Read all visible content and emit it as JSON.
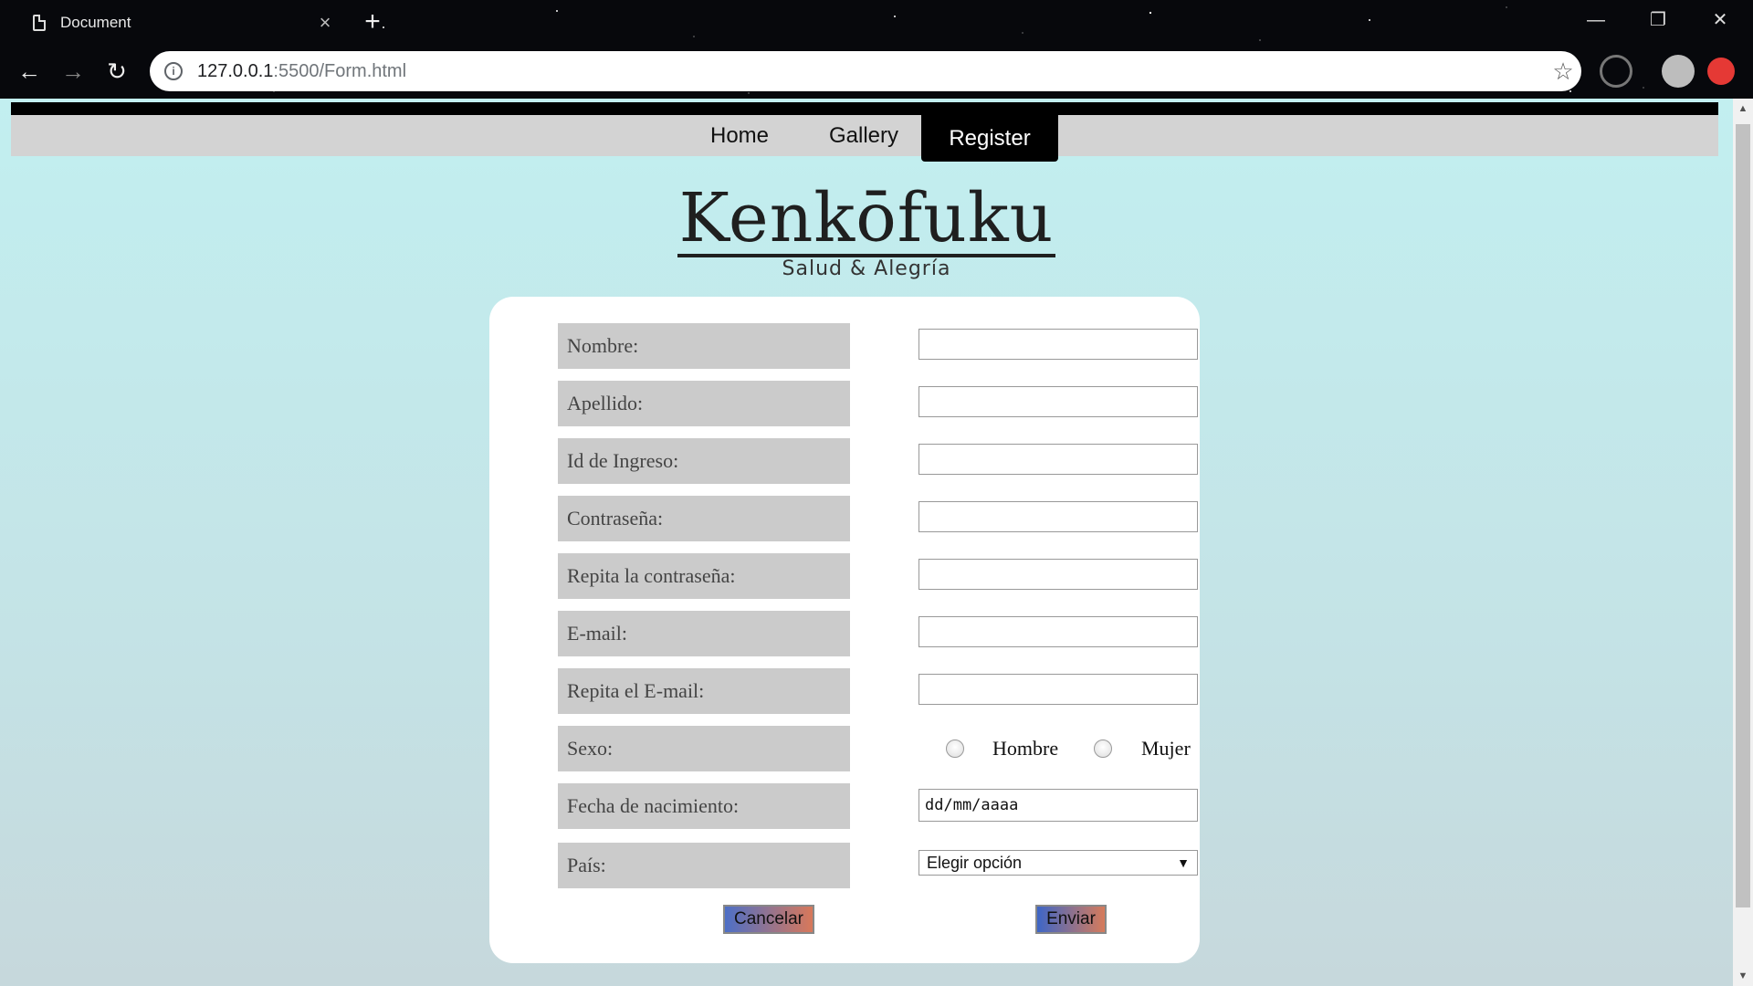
{
  "browser": {
    "tab_title": "Document",
    "tab_close": "×",
    "new_tab": "+",
    "url_host": "127.0.0.1",
    "url_path": ":5500/Form.html",
    "back": "←",
    "forward": "→",
    "reload": "↻",
    "star": "☆",
    "minimize": "—",
    "maximize": "❐",
    "close": "✕"
  },
  "nav": {
    "items": [
      {
        "label": "Home"
      },
      {
        "label": "Gallery"
      },
      {
        "label": "Register"
      }
    ],
    "active": "Register"
  },
  "brand": {
    "title": "Kenkōfuku",
    "tagline": "Salud & Alegría"
  },
  "form": {
    "fields": [
      {
        "label": "Nombre:",
        "value": ""
      },
      {
        "label": "Apellido:",
        "value": ""
      },
      {
        "label": "Id de Ingreso:",
        "value": ""
      },
      {
        "label": "Contraseña:",
        "value": ""
      },
      {
        "label": "Repita la contraseña:",
        "value": ""
      },
      {
        "label": "E-mail:",
        "value": ""
      },
      {
        "label": "Repita el E-mail:",
        "value": ""
      }
    ],
    "sex": {
      "label": "Sexo:",
      "options": [
        "Hombre",
        "Mujer"
      ]
    },
    "birthdate": {
      "label": "Fecha de nacimiento:",
      "placeholder": "dd/mm/aaaa"
    },
    "country": {
      "label": "País:",
      "selected": "Elegir opción",
      "caret": "▼"
    },
    "buttons": {
      "cancel": "Cancelar",
      "submit": "Enviar"
    }
  },
  "colors": {
    "page_bg_top": "#c2eff0",
    "label_bg": "#cbcbcb",
    "nav_bg": "#d3d3d3",
    "nav_active_bg": "#000000",
    "button_gradient_blue": "#4d6fc6",
    "button_gradient_orange": "#d8785a"
  }
}
